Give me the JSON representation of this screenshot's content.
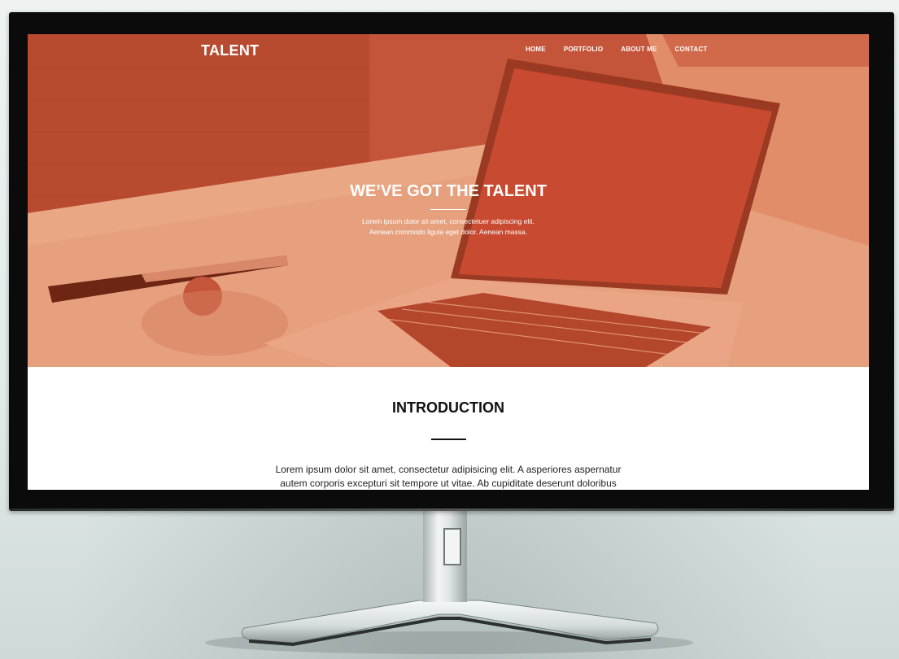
{
  "site": {
    "brand": "TALENT",
    "nav": [
      "HOME",
      "PORTFOLIO",
      "ABOUT ME",
      "CONTACT"
    ]
  },
  "hero": {
    "title": "WE’VE GOT THE TALENT",
    "subtitle_line1": "Lorem ipsum dolor sit amet, consectetuer adipiscing elit.",
    "subtitle_line2": "Aenean commodo ligula eget dolor. Aenean massa."
  },
  "intro": {
    "title": "INTRODUCTION",
    "text_line1": "Lorem ipsum dolor sit amet, consectetur adipisicing elit. A asperiores aspernatur",
    "text_line2": "autem corporis excepturi sit tempore ut vitae. Ab cupiditate deserunt doloribus ipsa"
  },
  "colors": {
    "hero_overlay": "#c7573a",
    "hero_light": "#e9a27f",
    "text_dark": "#111111",
    "white": "#ffffff"
  },
  "icons": {
    "illustration": "laptop-on-desk-photo",
    "racket": "ping-pong-paddle"
  }
}
